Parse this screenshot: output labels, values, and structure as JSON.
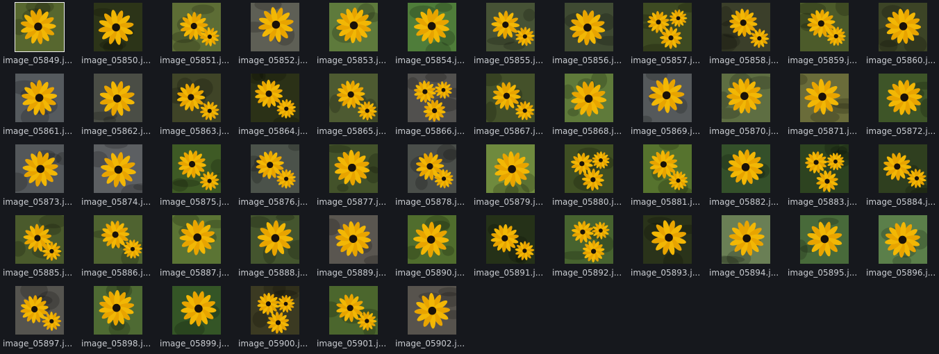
{
  "file_browser": {
    "files": [
      {
        "name": "image_05849.jpg",
        "label": "image_05849.j...",
        "selected": true,
        "bg": "#57672f",
        "n": 1
      },
      {
        "name": "image_05850.jpg",
        "label": "image_05850.j...",
        "bg": "#2c3418",
        "n": 1
      },
      {
        "name": "image_05851.jpg",
        "label": "image_05851.j...",
        "bg": "#5d6d35",
        "n": 2
      },
      {
        "name": "image_05852.jpg",
        "label": "image_05852.j...",
        "bg": "#5e5f55",
        "n": 1
      },
      {
        "name": "image_05853.jpg",
        "label": "image_05853.j...",
        "bg": "#5e7a3c",
        "n": 1
      },
      {
        "name": "image_05854.jpg",
        "label": "image_05854.j...",
        "bg": "#4f7d3a",
        "n": 1
      },
      {
        "name": "image_05855.jpg",
        "label": "image_05855.j...",
        "bg": "#465235",
        "n": 2
      },
      {
        "name": "image_05856.jpg",
        "label": "image_05856.j...",
        "bg": "#3f4a32",
        "n": 1
      },
      {
        "name": "image_05857.jpg",
        "label": "image_05857.j...",
        "bg": "#3d4a22",
        "n": 3
      },
      {
        "name": "image_05858.jpg",
        "label": "image_05858.j...",
        "bg": "#3b3f2a",
        "n": 2
      },
      {
        "name": "image_05859.jpg",
        "label": "image_05859.j...",
        "bg": "#4c5b2a",
        "n": 2
      },
      {
        "name": "image_05860.jpg",
        "label": "image_05860.j...",
        "bg": "#3c4426",
        "n": 1
      },
      {
        "name": "image_05861.jpg",
        "label": "image_05861.j...",
        "bg": "#555a5e",
        "n": 1
      },
      {
        "name": "image_05862.jpg",
        "label": "image_05862.j...",
        "bg": "#4a4d45",
        "n": 1
      },
      {
        "name": "image_05863.jpg",
        "label": "image_05863.j...",
        "bg": "#3f4427",
        "n": 2
      },
      {
        "name": "image_05864.jpg",
        "label": "image_05864.j...",
        "bg": "#2b3117",
        "n": 2
      },
      {
        "name": "image_05865.jpg",
        "label": "image_05865.j...",
        "bg": "#4d5a31",
        "n": 2
      },
      {
        "name": "image_05866.jpg",
        "label": "image_05866.j...",
        "bg": "#51504e",
        "n": 3
      },
      {
        "name": "image_05867.jpg",
        "label": "image_05867.j...",
        "bg": "#44512a",
        "n": 2
      },
      {
        "name": "image_05868.jpg",
        "label": "image_05868.j...",
        "bg": "#5f7a3a",
        "n": 1
      },
      {
        "name": "image_05869.jpg",
        "label": "image_05869.j...",
        "bg": "#55595b",
        "n": 1
      },
      {
        "name": "image_05870.jpg",
        "label": "image_05870.j...",
        "bg": "#5e6e42",
        "n": 1
      },
      {
        "name": "image_05871.jpg",
        "label": "image_05871.j...",
        "bg": "#6a6c3a",
        "n": 1
      },
      {
        "name": "image_05872.jpg",
        "label": "image_05872.j...",
        "bg": "#3e5528",
        "n": 1
      },
      {
        "name": "image_05873.jpg",
        "label": "image_05873.j...",
        "bg": "#53575a",
        "n": 1
      },
      {
        "name": "image_05874.jpg",
        "label": "image_05874.j...",
        "bg": "#5c5f62",
        "n": 1
      },
      {
        "name": "image_05875.jpg",
        "label": "image_05875.j...",
        "bg": "#3e5a25",
        "n": 2
      },
      {
        "name": "image_05876.jpg",
        "label": "image_05876.j...",
        "bg": "#4b524a",
        "n": 2
      },
      {
        "name": "image_05877.jpg",
        "label": "image_05877.j...",
        "bg": "#43522a",
        "n": 1
      },
      {
        "name": "image_05878.jpg",
        "label": "image_05878.j...",
        "bg": "#4a4e4a",
        "n": 2
      },
      {
        "name": "image_05879.jpg",
        "label": "image_05879.j...",
        "bg": "#6f8a3e",
        "n": 1
      },
      {
        "name": "image_05880.jpg",
        "label": "image_05880.j...",
        "bg": "#3f4f23",
        "n": 3
      },
      {
        "name": "image_05881.jpg",
        "label": "image_05881.j...",
        "bg": "#56732e",
        "n": 2
      },
      {
        "name": "image_05882.jpg",
        "label": "image_05882.j...",
        "bg": "#34502a",
        "n": 1
      },
      {
        "name": "image_05883.jpg",
        "label": "image_05883.j...",
        "bg": "#2d4320",
        "n": 3
      },
      {
        "name": "image_05884.jpg",
        "label": "image_05884.j...",
        "bg": "#2f3f1f",
        "n": 2
      },
      {
        "name": "image_05885.jpg",
        "label": "image_05885.j...",
        "bg": "#4a5a2c",
        "n": 2
      },
      {
        "name": "image_05886.jpg",
        "label": "image_05886.j...",
        "bg": "#4f6330",
        "n": 2
      },
      {
        "name": "image_05887.jpg",
        "label": "image_05887.j...",
        "bg": "#5b7434",
        "n": 1
      },
      {
        "name": "image_05888.jpg",
        "label": "image_05888.j...",
        "bg": "#44552e",
        "n": 1
      },
      {
        "name": "image_05889.jpg",
        "label": "image_05889.j...",
        "bg": "#5a5650",
        "n": 1
      },
      {
        "name": "image_05890.jpg",
        "label": "image_05890.j...",
        "bg": "#506d2d",
        "n": 1
      },
      {
        "name": "image_05891.jpg",
        "label": "image_05891.j...",
        "bg": "#253118",
        "n": 2
      },
      {
        "name": "image_05892.jpg",
        "label": "image_05892.j...",
        "bg": "#47632f",
        "n": 3
      },
      {
        "name": "image_05893.jpg",
        "label": "image_05893.j...",
        "bg": "#2a331a",
        "n": 1
      },
      {
        "name": "image_05894.jpg",
        "label": "image_05894.j...",
        "bg": "#6a7f55",
        "n": 1
      },
      {
        "name": "image_05895.jpg",
        "label": "image_05895.j...",
        "bg": "#486a3a",
        "n": 1
      },
      {
        "name": "image_05896.jpg",
        "label": "image_05896.j...",
        "bg": "#5b7f4a",
        "n": 1
      },
      {
        "name": "image_05897.jpg",
        "label": "image_05897.j...",
        "bg": "#55544f",
        "n": 2
      },
      {
        "name": "image_05898.jpg",
        "label": "image_05898.j...",
        "bg": "#4e6a33",
        "n": 1
      },
      {
        "name": "image_05899.jpg",
        "label": "image_05899.j...",
        "bg": "#345526",
        "n": 1
      },
      {
        "name": "image_05900.jpg",
        "label": "image_05900.j...",
        "bg": "#3b3a22",
        "n": 3
      },
      {
        "name": "image_05901.jpg",
        "label": "image_05901.j...",
        "bg": "#4b662d",
        "n": 2
      },
      {
        "name": "image_05902.jpg",
        "label": "image_05902.j...",
        "bg": "#57534d",
        "n": 1
      }
    ]
  }
}
